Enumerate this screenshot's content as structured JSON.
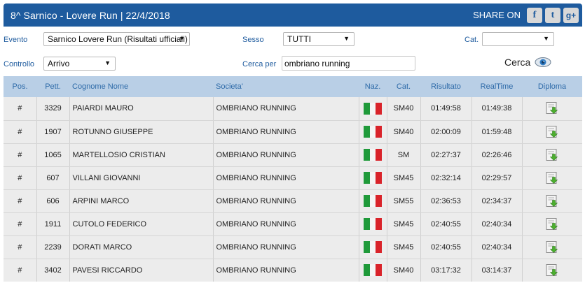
{
  "header": {
    "title": "8^ Sarnico - Lovere Run   |   22/4/2018",
    "share_label": "SHARE ON",
    "social": [
      {
        "icon": "facebook-icon",
        "glyph": "f"
      },
      {
        "icon": "twitter-icon",
        "glyph": "t"
      },
      {
        "icon": "google-plus-icon",
        "glyph": "g+"
      }
    ]
  },
  "filters": {
    "evento_label": "Evento",
    "evento_value": "Sarnico Lovere Run (Risultati ufficiali)",
    "sesso_label": "Sesso",
    "sesso_value": "TUTTI",
    "cat_label": "Cat.",
    "cat_value": "",
    "controllo_label": "Controllo",
    "controllo_value": "Arrivo",
    "cerca_per_label": "Cerca per",
    "cerca_per_value": "ombriano running",
    "cerca_button": "Cerca"
  },
  "table": {
    "columns": [
      "Pos.",
      "Pett.",
      "Cognome Nome",
      "Societa'",
      "Naz.",
      "Cat.",
      "Risultato",
      "RealTime",
      "Diploma"
    ],
    "rows": [
      {
        "pos": "#",
        "pett": "3329",
        "nome": "PAIARDI MAURO",
        "societa": "OMBRIANO RUNNING",
        "cat": "SM40",
        "risultato": "01:49:58",
        "realtime": "01:49:38"
      },
      {
        "pos": "#",
        "pett": "1907",
        "nome": "ROTUNNO GIUSEPPE",
        "societa": "OMBRIANO RUNNING",
        "cat": "SM40",
        "risultato": "02:00:09",
        "realtime": "01:59:48"
      },
      {
        "pos": "#",
        "pett": "1065",
        "nome": "MARTELLOSIO CRISTIAN",
        "societa": "OMBRIANO RUNNING",
        "cat": "SM",
        "risultato": "02:27:37",
        "realtime": "02:26:46"
      },
      {
        "pos": "#",
        "pett": "607",
        "nome": "VILLANI GIOVANNI",
        "societa": "OMBRIANO RUNNING",
        "cat": "SM45",
        "risultato": "02:32:14",
        "realtime": "02:29:57"
      },
      {
        "pos": "#",
        "pett": "606",
        "nome": "ARPINI MARCO",
        "societa": "OMBRIANO RUNNING",
        "cat": "SM55",
        "risultato": "02:36:53",
        "realtime": "02:34:37"
      },
      {
        "pos": "#",
        "pett": "1911",
        "nome": "CUTOLO FEDERICO",
        "societa": "OMBRIANO RUNNING",
        "cat": "SM45",
        "risultato": "02:40:55",
        "realtime": "02:40:34"
      },
      {
        "pos": "#",
        "pett": "2239",
        "nome": "DORATI MARCO",
        "societa": "OMBRIANO RUNNING",
        "cat": "SM45",
        "risultato": "02:40:55",
        "realtime": "02:40:34"
      },
      {
        "pos": "#",
        "pett": "3402",
        "nome": "PAVESI RICCARDO",
        "societa": "OMBRIANO RUNNING",
        "cat": "SM40",
        "risultato": "03:17:32",
        "realtime": "03:14:37"
      }
    ]
  },
  "colors": {
    "header_bg": "#1e5b9e",
    "table_header_bg": "#b9cfe6",
    "row_bg": "#ececec",
    "label_blue": "#1e5b9e"
  }
}
